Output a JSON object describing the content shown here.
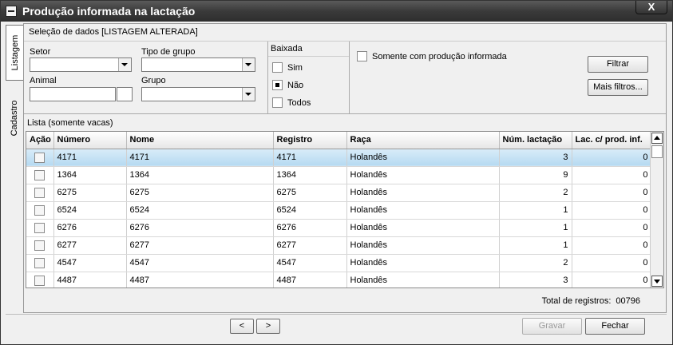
{
  "window": {
    "title": "Produção informada na lactação",
    "close_label": "X"
  },
  "tabs": [
    {
      "label": "Listagem"
    },
    {
      "label": "Cadastro"
    }
  ],
  "selecao": {
    "header": "Seleção de dados [LISTAGEM ALTERADA]",
    "setor_label": "Setor",
    "setor_value": "",
    "tipo_grupo_label": "Tipo de grupo",
    "tipo_grupo_value": "",
    "animal_label": "Animal",
    "animal_value": "",
    "grupo_label": "Grupo",
    "grupo_value": "",
    "baixada": {
      "label": "Baixada",
      "options": [
        {
          "label": "Sim",
          "checked": false
        },
        {
          "label": "Não",
          "checked": true
        },
        {
          "label": "Todos",
          "checked": false
        }
      ]
    },
    "somente_label": "Somente com produção informada",
    "filtrar_label": "Filtrar",
    "mais_filtros_label": "Mais filtros..."
  },
  "lista": {
    "label": "Lista (somente vacas)",
    "columns": [
      "Ação",
      "Número",
      "Nome",
      "Registro",
      "Raça",
      "Núm. lactação",
      "Lac. c/ prod. inf."
    ],
    "rows": [
      {
        "numero": "4171",
        "nome": "4171",
        "registro": "4171",
        "raca": "Holandês",
        "lactacao": "3",
        "lac_prod": "0",
        "selected": true
      },
      {
        "numero": "1364",
        "nome": "1364",
        "registro": "1364",
        "raca": "Holandês",
        "lactacao": "9",
        "lac_prod": "0",
        "selected": false
      },
      {
        "numero": "6275",
        "nome": "6275",
        "registro": "6275",
        "raca": "Holandês",
        "lactacao": "2",
        "lac_prod": "0",
        "selected": false
      },
      {
        "numero": "6524",
        "nome": "6524",
        "registro": "6524",
        "raca": "Holandês",
        "lactacao": "1",
        "lac_prod": "0",
        "selected": false
      },
      {
        "numero": "6276",
        "nome": "6276",
        "registro": "6276",
        "raca": "Holandês",
        "lactacao": "1",
        "lac_prod": "0",
        "selected": false
      },
      {
        "numero": "6277",
        "nome": "6277",
        "registro": "6277",
        "raca": "Holandês",
        "lactacao": "1",
        "lac_prod": "0",
        "selected": false
      },
      {
        "numero": "4547",
        "nome": "4547",
        "registro": "4547",
        "raca": "Holandês",
        "lactacao": "2",
        "lac_prod": "0",
        "selected": false
      },
      {
        "numero": "4487",
        "nome": "4487",
        "registro": "4487",
        "raca": "Holandês",
        "lactacao": "3",
        "lac_prod": "0",
        "selected": false
      }
    ],
    "total_label": "Total de registros:",
    "total_value": "00796"
  },
  "footer": {
    "prev_label": "<",
    "next_label": ">",
    "gravar_label": "Gravar",
    "fechar_label": "Fechar"
  }
}
